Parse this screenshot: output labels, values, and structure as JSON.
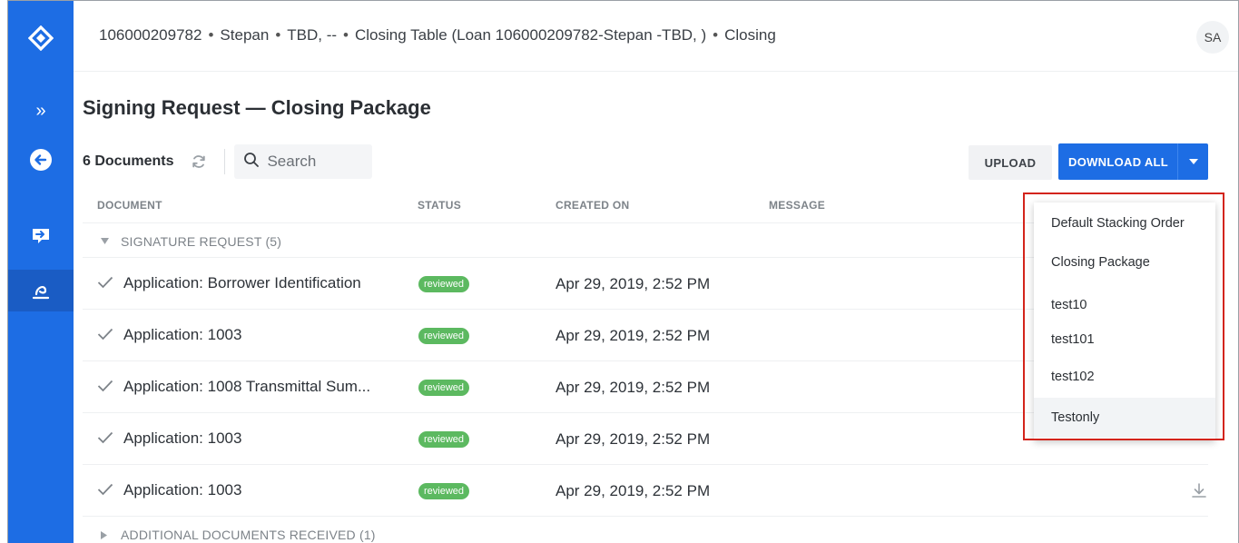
{
  "header": {
    "breadcrumb": [
      "106000209782",
      "Stepan",
      "TBD, --",
      "Closing Table (Loan 106000209782-Stepan -TBD, )",
      "Closing"
    ],
    "separator": "•",
    "avatar": "SA"
  },
  "sidebar": {
    "items": [
      {
        "icon": "logo-diamond-icon"
      },
      {
        "icon": "double-chevron-right-icon",
        "label": "»"
      },
      {
        "icon": "back-arrow-circle-icon"
      },
      {
        "icon": "inbox-arrow-icon"
      },
      {
        "icon": "signature-icon"
      }
    ]
  },
  "page": {
    "title": "Signing Request — Closing Package"
  },
  "toolbar": {
    "doc_count": "6 Documents",
    "search_placeholder": "Search",
    "upload_label": "UPLOAD",
    "download_all_label": "DOWNLOAD ALL"
  },
  "table": {
    "columns": [
      "DOCUMENT",
      "STATUS",
      "CREATED ON",
      "MESSAGE"
    ],
    "groups": [
      {
        "label": "SIGNATURE REQUEST (5)",
        "expanded": true,
        "rows": [
          {
            "name": "Application: Borrower Identification",
            "status": "reviewed",
            "created": "Apr 29, 2019, 2:52 PM"
          },
          {
            "name": "Application: 1003",
            "status": "reviewed",
            "created": "Apr 29, 2019, 2:52 PM"
          },
          {
            "name": "Application: 1008 Transmittal Sum...",
            "status": "reviewed",
            "created": "Apr 29, 2019, 2:52 PM"
          },
          {
            "name": "Application: 1003",
            "status": "reviewed",
            "created": "Apr 29, 2019, 2:52 PM"
          },
          {
            "name": "Application: 1003",
            "status": "reviewed",
            "created": "Apr 29, 2019, 2:52 PM"
          }
        ]
      },
      {
        "label": "ADDITIONAL DOCUMENTS RECEIVED (1)",
        "expanded": false
      }
    ]
  },
  "dropdown": {
    "items": [
      "Default Stacking Order",
      "Closing Package",
      "test10",
      "test101",
      "test102",
      "Testonly"
    ],
    "highlighted": "Testonly"
  },
  "colors": {
    "primary": "#1d6de4",
    "status_reviewed": "#5cb960",
    "highlight_box": "#d3241c"
  }
}
